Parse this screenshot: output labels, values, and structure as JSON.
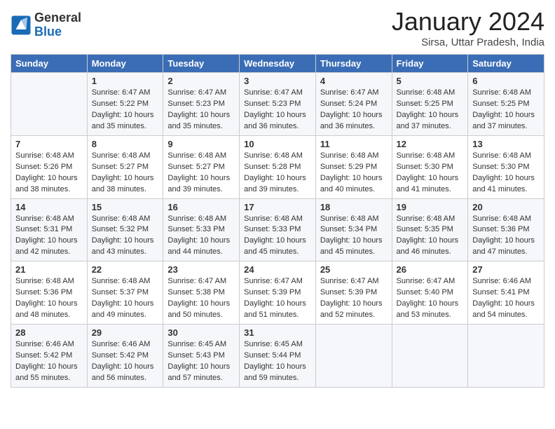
{
  "header": {
    "logo_general": "General",
    "logo_blue": "Blue",
    "month_year": "January 2024",
    "location": "Sirsa, Uttar Pradesh, India"
  },
  "days_of_week": [
    "Sunday",
    "Monday",
    "Tuesday",
    "Wednesday",
    "Thursday",
    "Friday",
    "Saturday"
  ],
  "weeks": [
    [
      {
        "day": "",
        "info": ""
      },
      {
        "day": "1",
        "info": "Sunrise: 6:47 AM\nSunset: 5:22 PM\nDaylight: 10 hours\nand 35 minutes."
      },
      {
        "day": "2",
        "info": "Sunrise: 6:47 AM\nSunset: 5:23 PM\nDaylight: 10 hours\nand 35 minutes."
      },
      {
        "day": "3",
        "info": "Sunrise: 6:47 AM\nSunset: 5:23 PM\nDaylight: 10 hours\nand 36 minutes."
      },
      {
        "day": "4",
        "info": "Sunrise: 6:47 AM\nSunset: 5:24 PM\nDaylight: 10 hours\nand 36 minutes."
      },
      {
        "day": "5",
        "info": "Sunrise: 6:48 AM\nSunset: 5:25 PM\nDaylight: 10 hours\nand 37 minutes."
      },
      {
        "day": "6",
        "info": "Sunrise: 6:48 AM\nSunset: 5:25 PM\nDaylight: 10 hours\nand 37 minutes."
      }
    ],
    [
      {
        "day": "7",
        "info": "Sunrise: 6:48 AM\nSunset: 5:26 PM\nDaylight: 10 hours\nand 38 minutes."
      },
      {
        "day": "8",
        "info": "Sunrise: 6:48 AM\nSunset: 5:27 PM\nDaylight: 10 hours\nand 38 minutes."
      },
      {
        "day": "9",
        "info": "Sunrise: 6:48 AM\nSunset: 5:27 PM\nDaylight: 10 hours\nand 39 minutes."
      },
      {
        "day": "10",
        "info": "Sunrise: 6:48 AM\nSunset: 5:28 PM\nDaylight: 10 hours\nand 39 minutes."
      },
      {
        "day": "11",
        "info": "Sunrise: 6:48 AM\nSunset: 5:29 PM\nDaylight: 10 hours\nand 40 minutes."
      },
      {
        "day": "12",
        "info": "Sunrise: 6:48 AM\nSunset: 5:30 PM\nDaylight: 10 hours\nand 41 minutes."
      },
      {
        "day": "13",
        "info": "Sunrise: 6:48 AM\nSunset: 5:30 PM\nDaylight: 10 hours\nand 41 minutes."
      }
    ],
    [
      {
        "day": "14",
        "info": "Sunrise: 6:48 AM\nSunset: 5:31 PM\nDaylight: 10 hours\nand 42 minutes."
      },
      {
        "day": "15",
        "info": "Sunrise: 6:48 AM\nSunset: 5:32 PM\nDaylight: 10 hours\nand 43 minutes."
      },
      {
        "day": "16",
        "info": "Sunrise: 6:48 AM\nSunset: 5:33 PM\nDaylight: 10 hours\nand 44 minutes."
      },
      {
        "day": "17",
        "info": "Sunrise: 6:48 AM\nSunset: 5:33 PM\nDaylight: 10 hours\nand 45 minutes."
      },
      {
        "day": "18",
        "info": "Sunrise: 6:48 AM\nSunset: 5:34 PM\nDaylight: 10 hours\nand 45 minutes."
      },
      {
        "day": "19",
        "info": "Sunrise: 6:48 AM\nSunset: 5:35 PM\nDaylight: 10 hours\nand 46 minutes."
      },
      {
        "day": "20",
        "info": "Sunrise: 6:48 AM\nSunset: 5:36 PM\nDaylight: 10 hours\nand 47 minutes."
      }
    ],
    [
      {
        "day": "21",
        "info": "Sunrise: 6:48 AM\nSunset: 5:36 PM\nDaylight: 10 hours\nand 48 minutes."
      },
      {
        "day": "22",
        "info": "Sunrise: 6:48 AM\nSunset: 5:37 PM\nDaylight: 10 hours\nand 49 minutes."
      },
      {
        "day": "23",
        "info": "Sunrise: 6:47 AM\nSunset: 5:38 PM\nDaylight: 10 hours\nand 50 minutes."
      },
      {
        "day": "24",
        "info": "Sunrise: 6:47 AM\nSunset: 5:39 PM\nDaylight: 10 hours\nand 51 minutes."
      },
      {
        "day": "25",
        "info": "Sunrise: 6:47 AM\nSunset: 5:39 PM\nDaylight: 10 hours\nand 52 minutes."
      },
      {
        "day": "26",
        "info": "Sunrise: 6:47 AM\nSunset: 5:40 PM\nDaylight: 10 hours\nand 53 minutes."
      },
      {
        "day": "27",
        "info": "Sunrise: 6:46 AM\nSunset: 5:41 PM\nDaylight: 10 hours\nand 54 minutes."
      }
    ],
    [
      {
        "day": "28",
        "info": "Sunrise: 6:46 AM\nSunset: 5:42 PM\nDaylight: 10 hours\nand 55 minutes."
      },
      {
        "day": "29",
        "info": "Sunrise: 6:46 AM\nSunset: 5:42 PM\nDaylight: 10 hours\nand 56 minutes."
      },
      {
        "day": "30",
        "info": "Sunrise: 6:45 AM\nSunset: 5:43 PM\nDaylight: 10 hours\nand 57 minutes."
      },
      {
        "day": "31",
        "info": "Sunrise: 6:45 AM\nSunset: 5:44 PM\nDaylight: 10 hours\nand 59 minutes."
      },
      {
        "day": "",
        "info": ""
      },
      {
        "day": "",
        "info": ""
      },
      {
        "day": "",
        "info": ""
      }
    ]
  ]
}
